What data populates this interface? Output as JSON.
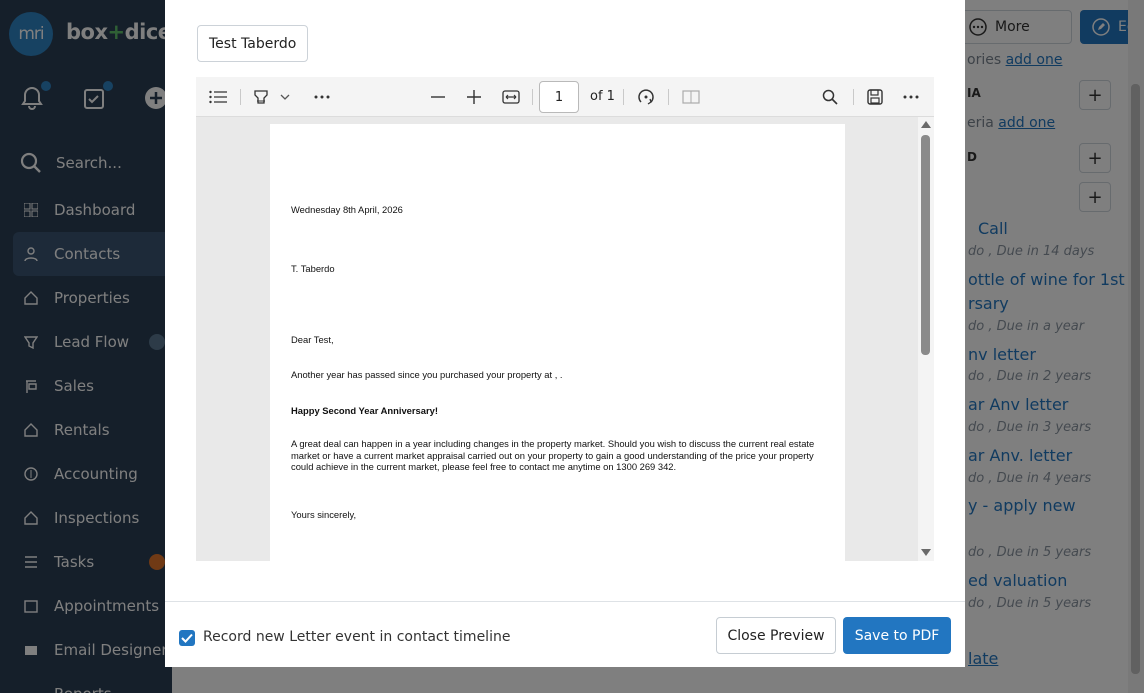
{
  "app": {
    "brand_prefix": "box",
    "brand_plus": "+",
    "brand_suffix": "dice",
    "logo_text": "mri",
    "search_placeholder": "Search...",
    "nav": [
      {
        "label": "Dashboard",
        "icon": "grid-icon"
      },
      {
        "label": "Contacts",
        "icon": "person-icon",
        "active": true
      },
      {
        "label": "Properties",
        "icon": "house-icon"
      },
      {
        "label": "Lead Flow",
        "icon": "funnel-icon"
      },
      {
        "label": "Sales",
        "icon": "sign-icon"
      },
      {
        "label": "Rentals",
        "icon": "house-key-icon"
      },
      {
        "label": "Accounting",
        "icon": "dollar-icon"
      },
      {
        "label": "Inspections",
        "icon": "house-search-icon"
      },
      {
        "label": "Tasks",
        "icon": "checklist-icon"
      },
      {
        "label": "Appointments",
        "icon": "calendar-icon"
      },
      {
        "label": "Email Designer",
        "icon": "mail-icon"
      },
      {
        "label": "Reports",
        "icon": "report-icon"
      }
    ],
    "header": {
      "more_label": "More",
      "edit_label": "Edit"
    },
    "background_panel": {
      "categories_prefix": "ories",
      "categories_link": "add one",
      "criteria_heading": "IA",
      "criteria_prefix": "eria",
      "criteria_link": "add one",
      "heading_2": "D",
      "events": [
        {
          "title": "Call",
          "meta": "do , Due in 14 days"
        },
        {
          "title": "ottle of wine for 1st",
          "title2": "rsary",
          "meta": "do , Due in a year"
        },
        {
          "title": "nv letter",
          "meta": "do , Due in 2 years"
        },
        {
          "title": "ar Anv letter",
          "meta": "do , Due in 3 years"
        },
        {
          "title": "ar Anv. letter",
          "meta": "do , Due in 4 years"
        },
        {
          "title": "y - apply new",
          "meta": "do , Due in 5 years"
        },
        {
          "title": "ed valuation",
          "meta": "do , Due in 5 years"
        }
      ],
      "template_link": "late"
    }
  },
  "modal": {
    "tab_label": "Test Taberdo",
    "viewer": {
      "current_page": "1",
      "page_total": "of 1"
    },
    "letter": {
      "date": "Wednesday 8th April, 2026",
      "recipient": "T. Taberdo",
      "salutation": "Dear Test,",
      "para1": "Another year has passed since you purchased your property at , .",
      "heading": "Happy Second Year Anniversary!",
      "para2": "A great deal can happen in a year including changes in the property market. Should you wish to discuss the current real estate market or have a current market appraisal carried out on your property to gain a good understanding of the price your property could achieve in the current market, please feel free to contact me anytime on 1300 269 342.",
      "closing": "Yours sincerely,"
    },
    "footer": {
      "checkbox_label": "Record new Letter event in contact timeline",
      "checkbox_checked": true,
      "close_label": "Close Preview",
      "save_label": "Save to PDF"
    }
  },
  "colors": {
    "primary": "#2276c1",
    "sidebar": "#2b3f55",
    "accent_green": "#5ec06b"
  }
}
